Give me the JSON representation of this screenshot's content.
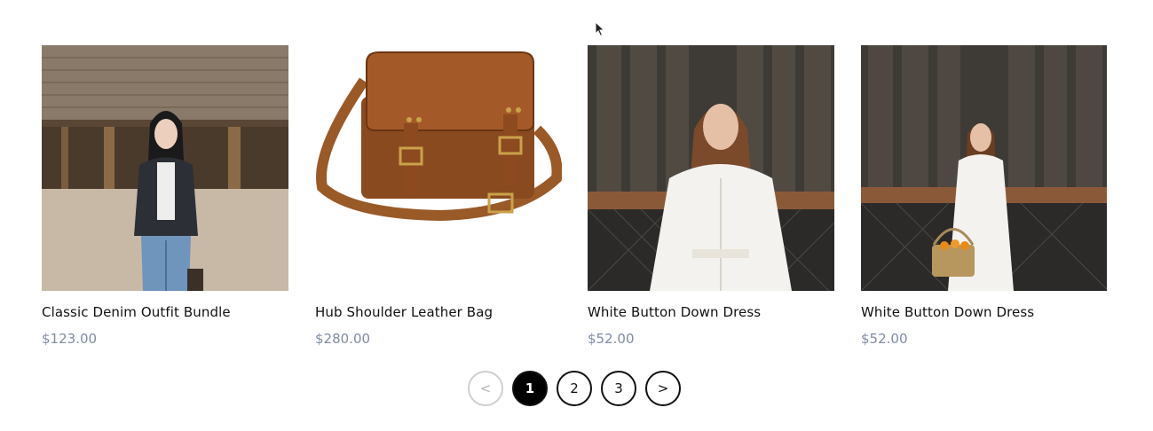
{
  "products": [
    {
      "title": "Classic Denim Outfit Bundle",
      "price": "$123.00",
      "image_icon": "woman-denim-jacket-photo"
    },
    {
      "title": "Hub Shoulder Leather Bag",
      "price": "$280.00",
      "image_icon": "leather-bag-photo"
    },
    {
      "title": "White Button Down Dress",
      "price": "$52.00",
      "image_icon": "woman-white-dress-photo"
    },
    {
      "title": "White Button Down Dress",
      "price": "$52.00",
      "image_icon": "woman-white-dress-basket-photo"
    }
  ],
  "pagination": {
    "prev_label": "<",
    "pages": [
      "1",
      "2",
      "3"
    ],
    "current_page": "1",
    "next_label": ">"
  },
  "colors": {
    "price": "#7e8ca3",
    "active_page_bg": "#000000",
    "disabled_border": "#cfcfcf"
  }
}
